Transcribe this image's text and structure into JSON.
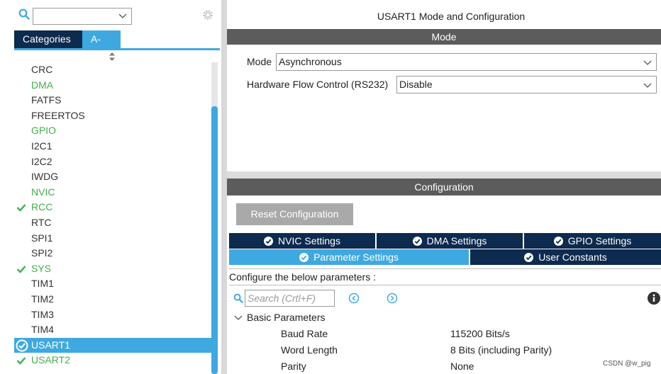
{
  "left_panel": {
    "tabs": {
      "categories": "Categories",
      "az": "A->Z"
    },
    "items": [
      {
        "label": "CRC",
        "state": "normal"
      },
      {
        "label": "DMA",
        "state": "green"
      },
      {
        "label": "FATFS",
        "state": "normal"
      },
      {
        "label": "FREERTOS",
        "state": "normal"
      },
      {
        "label": "GPIO",
        "state": "green"
      },
      {
        "label": "I2C1",
        "state": "normal"
      },
      {
        "label": "I2C2",
        "state": "normal"
      },
      {
        "label": "IWDG",
        "state": "normal"
      },
      {
        "label": "NVIC",
        "state": "green"
      },
      {
        "label": "RCC",
        "state": "checked"
      },
      {
        "label": "RTC",
        "state": "normal"
      },
      {
        "label": "SPI1",
        "state": "normal"
      },
      {
        "label": "SPI2",
        "state": "normal"
      },
      {
        "label": "SYS",
        "state": "checked"
      },
      {
        "label": "TIM1",
        "state": "normal"
      },
      {
        "label": "TIM2",
        "state": "normal"
      },
      {
        "label": "TIM3",
        "state": "normal"
      },
      {
        "label": "TIM4",
        "state": "normal"
      },
      {
        "label": "USART1",
        "state": "selected"
      },
      {
        "label": "USART2",
        "state": "checked"
      }
    ]
  },
  "right_panel": {
    "title": "USART1 Mode and Configuration",
    "mode_section": {
      "header": "Mode",
      "mode_label": "Mode",
      "mode_value": "Asynchronous",
      "flow_label": "Hardware Flow Control (RS232)",
      "flow_value": "Disable"
    },
    "config_section": {
      "header": "Configuration",
      "reset_button": "Reset Configuration",
      "tabs_row1": [
        "NVIC Settings",
        "DMA Settings",
        "GPIO Settings"
      ],
      "tabs_row2": [
        "Parameter Settings",
        "User Constants"
      ],
      "configure_text": "Configure the below parameters :",
      "search_placeholder": "Search (Crtl+F)",
      "group_label": "Basic Parameters",
      "params": [
        {
          "name": "Baud Rate",
          "value": "115200 Bits/s"
        },
        {
          "name": "Word Length",
          "value": "8 Bits (including Parity)"
        },
        {
          "name": "Parity",
          "value": "None"
        }
      ]
    }
  },
  "watermark": "CSDN @w_pig",
  "colors": {
    "accent_blue": "#3ea9e0",
    "dark_navy": "#0d2a4f",
    "section_gray": "#5c5c5c",
    "green_text": "#3fb04a"
  }
}
